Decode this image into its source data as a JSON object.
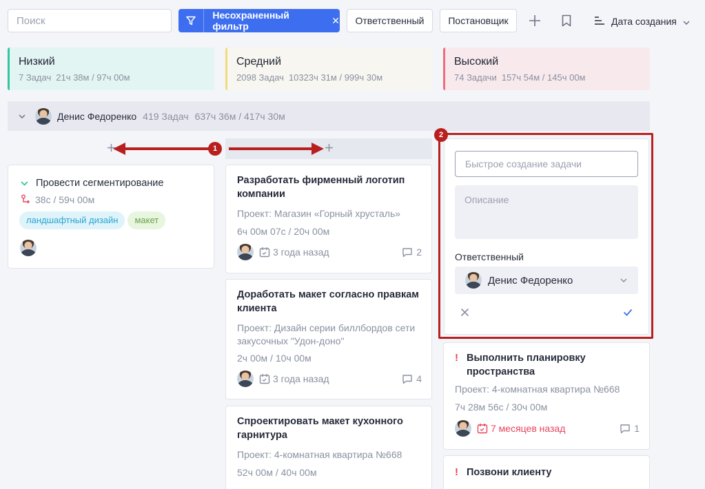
{
  "toolbar": {
    "search_placeholder": "Поиск",
    "filter_label": "Несохраненный фильтр",
    "responsible_label": "Ответственный",
    "creator_label": "Постановщик",
    "sort_label": "Дата создания"
  },
  "priorities": [
    {
      "title": "Низкий",
      "count": "7 Задач",
      "time": "21ч 38м / 97ч 00м",
      "color": "#34c4a0",
      "bg": "#e3f5f3"
    },
    {
      "title": "Средний",
      "count": "2098 Задач",
      "time": "10323ч 31м / 999ч 30м",
      "color": "#f1dc7c",
      "bg": "#f7f6f1"
    },
    {
      "title": "Высокий",
      "count": "74 Задачи",
      "time": "157ч 54м / 145ч 00м",
      "color": "#f06c7c",
      "bg": "#f8e9ec"
    }
  ],
  "group": {
    "name": "Денис Федоренко",
    "count": "419 Задач",
    "time": "637ч 36м / 417ч 30м"
  },
  "annotations": {
    "one": "1",
    "two": "2"
  },
  "cards": {
    "low1": {
      "title": "Провести сегментирование",
      "time": "38с / 59ч 00м",
      "tags": [
        "ландшафтный дизайн",
        "макет"
      ]
    },
    "mid1": {
      "title": "Разработать фирменный логотип компании",
      "project": "Проект: Магазин «Горный хрусталь»",
      "time": "6ч 00м 07с / 20ч 00м",
      "date": "3 года назад",
      "comments": "2"
    },
    "mid2": {
      "title": "Доработать макет согласно правкам клиента",
      "project": "Проект: Дизайн серии биллбордов сети закусочных \"Удон-доно\"",
      "time": "2ч 00м / 10ч 00м",
      "date": "3 года назад",
      "comments": "4"
    },
    "mid3": {
      "title": "Спроектировать макет кухонного гарнитура",
      "project": "Проект: 4-комнатная квартира №668",
      "time": "52ч 00м / 40ч 00м"
    },
    "high1": {
      "title": "Выполнить планировку пространства",
      "project": "Проект: 4-комнатная квартира №668",
      "time": "7ч 28м 56с / 30ч 00м",
      "date": "7 месяцев назад",
      "comments": "1"
    },
    "high2": {
      "title": "Позвони клиенту"
    }
  },
  "quick_create": {
    "title_placeholder": "Быстрое создание задачи",
    "desc_placeholder": "Описание",
    "responsible_label": "Ответственный",
    "responsible_value": "Денис Федоренко"
  },
  "colors": {
    "accent": "#3d6ef0",
    "annotation": "#b8201f",
    "overdue": "#e8435a"
  }
}
